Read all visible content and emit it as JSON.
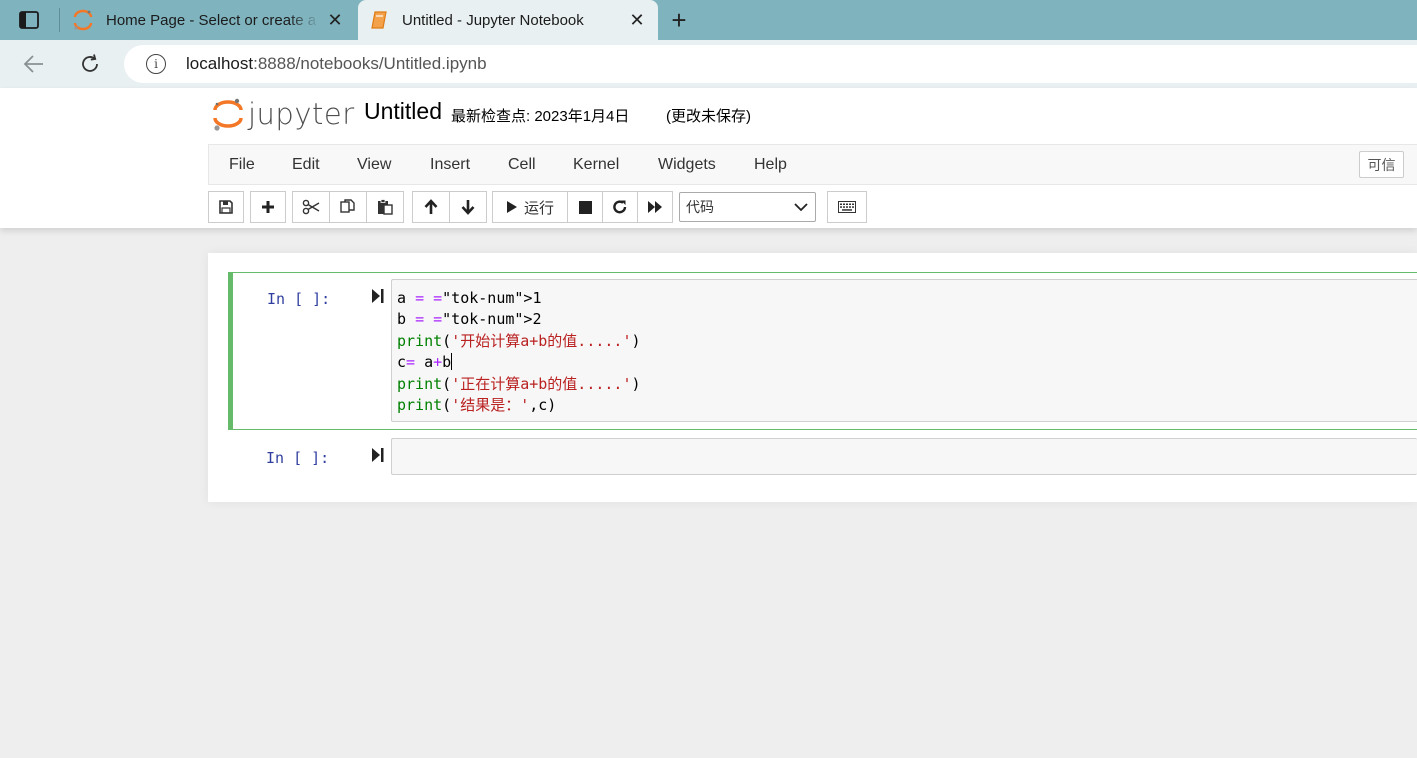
{
  "browser": {
    "tabs": [
      {
        "title": "Home Page - Select or create a notebook",
        "favicon": "jupyter-favicon",
        "active": false
      },
      {
        "title": "Untitled - Jupyter Notebook",
        "favicon": "notebook-favicon",
        "active": true
      }
    ],
    "close_glyph": "✕",
    "new_tab_glyph": "+",
    "url_host": "localhost",
    "url_rest": ":8888/notebooks/Untitled.ipynb",
    "info_glyph": "i"
  },
  "header": {
    "logo_text": "jupyter",
    "notebook_title": "Untitled",
    "checkpoint": "最新检查点: 2023年1月4日",
    "autosave_status": "(更改未保存)"
  },
  "menu": {
    "items": [
      "File",
      "Edit",
      "View",
      "Insert",
      "Cell",
      "Kernel",
      "Widgets",
      "Help"
    ],
    "trusted_label": "可信"
  },
  "toolbar": {
    "run_label": "运行",
    "cell_type": "代码"
  },
  "cells": [
    {
      "prompt": "In [ ]:",
      "lines": [
        "a = 1",
        "b = 2",
        "print('开始计算a+b的值.....')",
        "c= a+b",
        "print('正在计算a+b的值.....')",
        "print('结果是：',c)"
      ]
    },
    {
      "prompt": "In [ ]:",
      "lines": []
    }
  ],
  "colors": {
    "tabstrip": "#7fb4bf",
    "active_tab": "#e9f0f1",
    "selected_cell_border": "#66bb6a",
    "prompt": "#303f9f",
    "jupyter_orange": "#f37726"
  }
}
